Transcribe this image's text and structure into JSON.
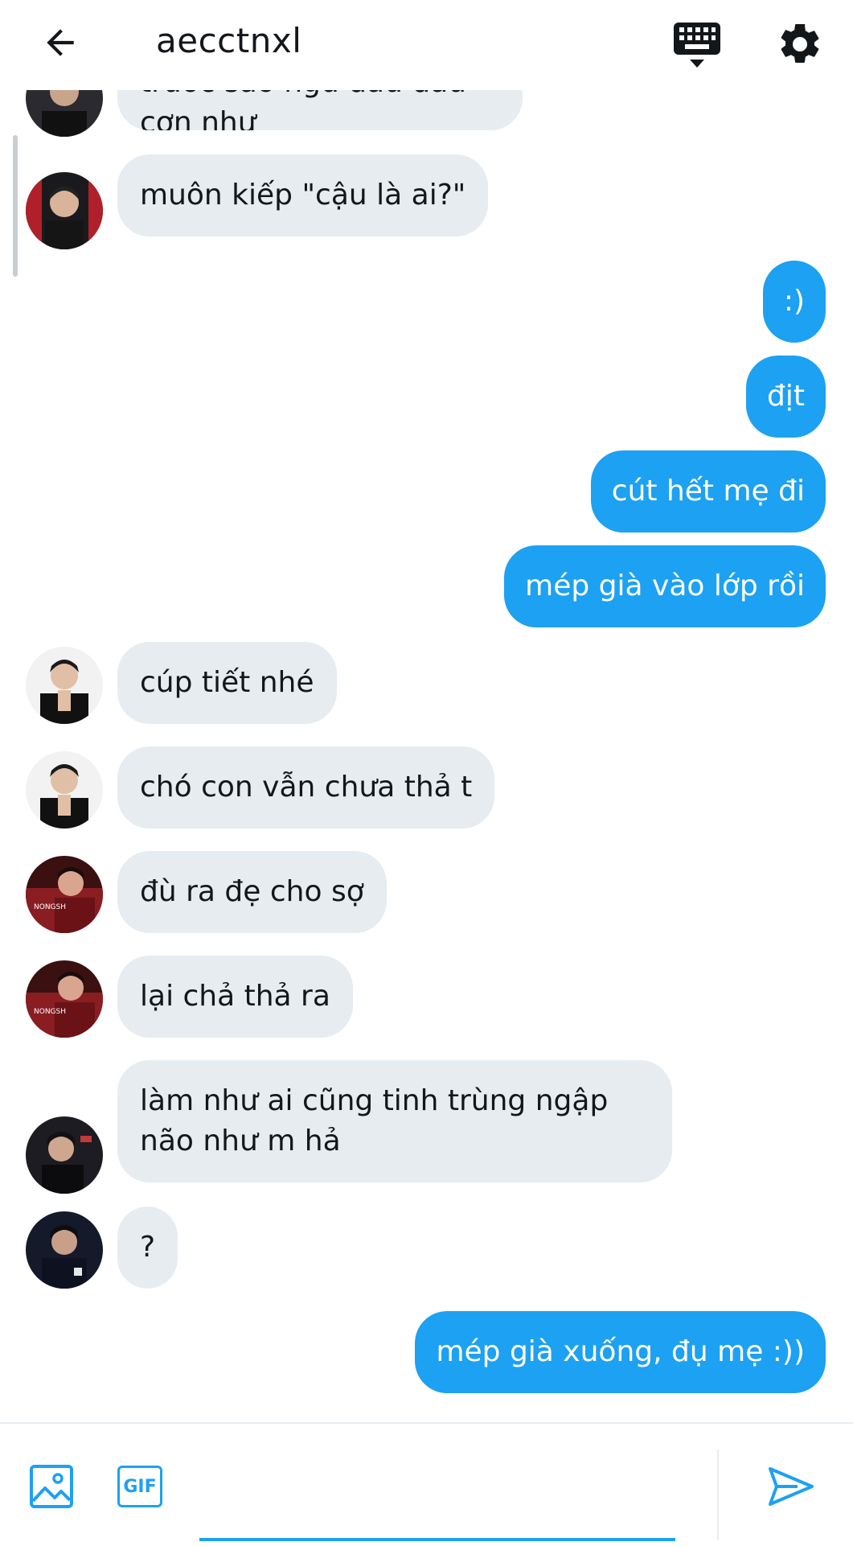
{
  "header": {
    "title": "aecctnxl",
    "back_icon": "arrow-left-icon",
    "keyboard_icon": "keyboard-icon",
    "settings_icon": "gear-icon"
  },
  "messages": [
    {
      "dir": "in",
      "text": "trước sao ngủ đâu đâu cơn như",
      "avatar": "avatar-dark"
    },
    {
      "dir": "in",
      "text": "muôn kiếp \"cậu là ai?\"",
      "avatar": "avatar-red-black"
    },
    {
      "dir": "out",
      "text": ":)"
    },
    {
      "dir": "out",
      "text": "địt"
    },
    {
      "dir": "out",
      "text": "cút hết mẹ đi"
    },
    {
      "dir": "out",
      "text": "mép già vào lớp rồi"
    },
    {
      "dir": "in",
      "text": "cúp tiết nhé",
      "avatar": "avatar-white"
    },
    {
      "dir": "in",
      "text": "chó con vẫn chưa thả t",
      "avatar": "avatar-white"
    },
    {
      "dir": "in",
      "text": "đù ra đẹ cho sợ",
      "avatar": "avatar-red"
    },
    {
      "dir": "in",
      "text": "lại chả thả ra",
      "avatar": "avatar-red"
    },
    {
      "dir": "in",
      "text": "làm như ai cũng tinh trùng ngập não như m hả",
      "avatar": "avatar-dark-2"
    },
    {
      "dir": "in",
      "text": "?",
      "avatar": "avatar-navy"
    },
    {
      "dir": "out",
      "text": "mép già xuống, đụ mẹ :))"
    }
  ],
  "composer": {
    "image_icon": "image-icon",
    "gif_label": "GIF",
    "placeholder": "",
    "send_icon": "send-icon"
  },
  "colors": {
    "accent": "#1da1f2",
    "incoming_bubble": "#e6ecf0",
    "text": "#14171a"
  }
}
